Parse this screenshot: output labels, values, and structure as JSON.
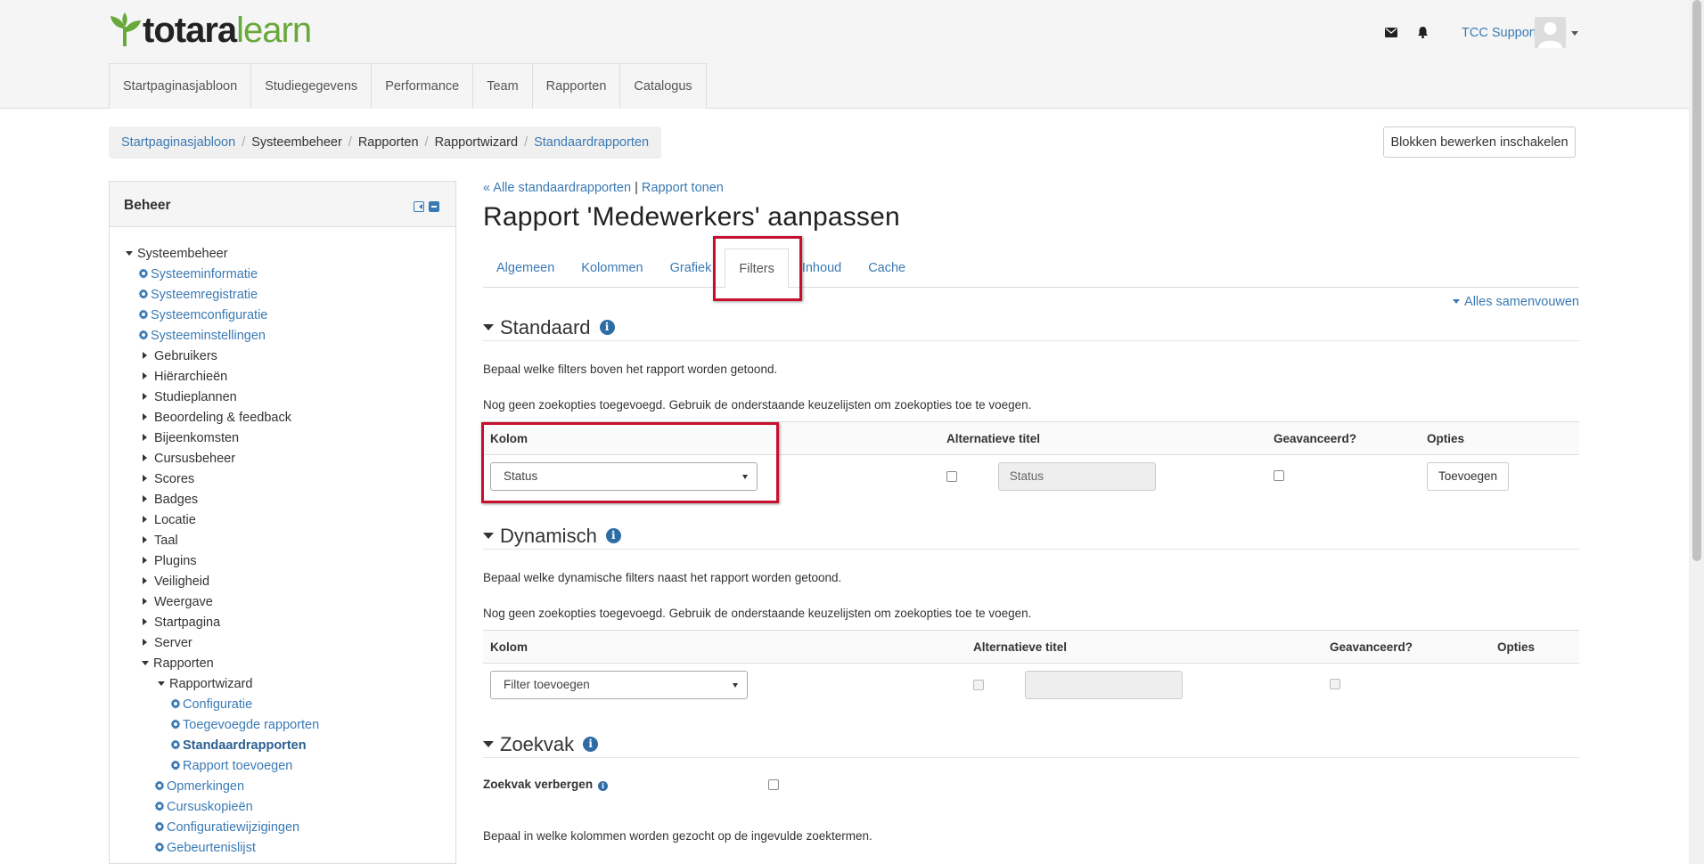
{
  "brand": {
    "logo_part1": "totara",
    "logo_part2": "learn",
    "accent": "#69a83a"
  },
  "header": {
    "user_name": "TCC Support"
  },
  "nav": [
    "Startpaginasjabloon",
    "Studiegegevens",
    "Performance",
    "Team",
    "Rapporten",
    "Catalogus"
  ],
  "breadcrumb": [
    "Startpaginasjabloon",
    "Systeembeheer",
    "Rapporten",
    "Rapportwizard",
    "Standaardrapporten"
  ],
  "edit_button": "Blokken bewerken inschakelen",
  "block": {
    "title": "Beheer",
    "tree": [
      {
        "label": "Systeembeheer",
        "type": "open",
        "level": 0
      },
      {
        "label": "Systeeminformatie",
        "type": "gear",
        "level": 1
      },
      {
        "label": "Systeemregistratie",
        "type": "gear",
        "level": 1
      },
      {
        "label": "Systeemconfiguratie",
        "type": "gear",
        "level": 1
      },
      {
        "label": "Systeeminstellingen",
        "type": "gear",
        "level": 1
      },
      {
        "label": "Gebruikers",
        "type": "closed",
        "level": 1
      },
      {
        "label": "Hiërarchieën",
        "type": "closed",
        "level": 1
      },
      {
        "label": "Studieplannen",
        "type": "closed",
        "level": 1
      },
      {
        "label": "Beoordeling & feedback",
        "type": "closed",
        "level": 1
      },
      {
        "label": "Bijeenkomsten",
        "type": "closed",
        "level": 1
      },
      {
        "label": "Cursusbeheer",
        "type": "closed",
        "level": 1
      },
      {
        "label": "Scores",
        "type": "closed",
        "level": 1
      },
      {
        "label": "Badges",
        "type": "closed",
        "level": 1
      },
      {
        "label": "Locatie",
        "type": "closed",
        "level": 1
      },
      {
        "label": "Taal",
        "type": "closed",
        "level": 1
      },
      {
        "label": "Plugins",
        "type": "closed",
        "level": 1
      },
      {
        "label": "Veiligheid",
        "type": "closed",
        "level": 1
      },
      {
        "label": "Weergave",
        "type": "closed",
        "level": 1
      },
      {
        "label": "Startpagina",
        "type": "closed",
        "level": 1
      },
      {
        "label": "Server",
        "type": "closed",
        "level": 1
      },
      {
        "label": "Rapporten",
        "type": "open",
        "level": 1
      },
      {
        "label": "Rapportwizard",
        "type": "open",
        "level": 2
      },
      {
        "label": "Configuratie",
        "type": "gear",
        "level": 3
      },
      {
        "label": "Toegevoegde rapporten",
        "type": "gear",
        "level": 3
      },
      {
        "label": "Standaardrapporten",
        "type": "gear",
        "level": 3,
        "active": true
      },
      {
        "label": "Rapport toevoegen",
        "type": "gear",
        "level": 3
      },
      {
        "label": "Opmerkingen",
        "type": "gear",
        "level": 2
      },
      {
        "label": "Cursuskopieën",
        "type": "gear",
        "level": 2
      },
      {
        "label": "Configuratiewijzigingen",
        "type": "gear",
        "level": 2
      },
      {
        "label": "Gebeurtenislijst",
        "type": "gear",
        "level": 2
      }
    ]
  },
  "main": {
    "link_all": "« Alle standaardrapporten",
    "link_sep": "|",
    "link_show": "Rapport tonen",
    "title": "Rapport 'Medewerkers' aanpassen",
    "tabs": [
      "Algemeen",
      "Kolommen",
      "Grafiek",
      "Filters",
      "Inhoud",
      "Cache"
    ],
    "active_tab": "Filters",
    "collapse_all": "Alles samenvouwen",
    "standard": {
      "heading": "Standaard",
      "desc": "Bepaal welke filters boven het rapport worden getoond.",
      "empty": "Nog geen zoekopties toegevoegd. Gebruik de onderstaande keuzelijsten om zoekopties toe te voegen.",
      "columns": [
        "Kolom",
        "Alternatieve titel",
        "Geavanceerd?",
        "Opties"
      ],
      "select_value": "Status",
      "alt_title_value": "Status",
      "add_button": "Toevoegen"
    },
    "dynamic": {
      "heading": "Dynamisch",
      "desc": "Bepaal welke dynamische filters naast het rapport worden getoond.",
      "empty": "Nog geen zoekopties toegevoegd. Gebruik de onderstaande keuzelijsten om zoekopties toe te voegen.",
      "columns": [
        "Kolom",
        "Alternatieve titel",
        "Geavanceerd?",
        "Opties"
      ],
      "select_value": "Filter toevoegen"
    },
    "search": {
      "heading": "Zoekvak",
      "hide_label": "Zoekvak verbergen",
      "desc": "Bepaal in welke kolommen worden gezocht op de ingevulde zoektermen."
    }
  },
  "highlight_color": "#c8102e"
}
